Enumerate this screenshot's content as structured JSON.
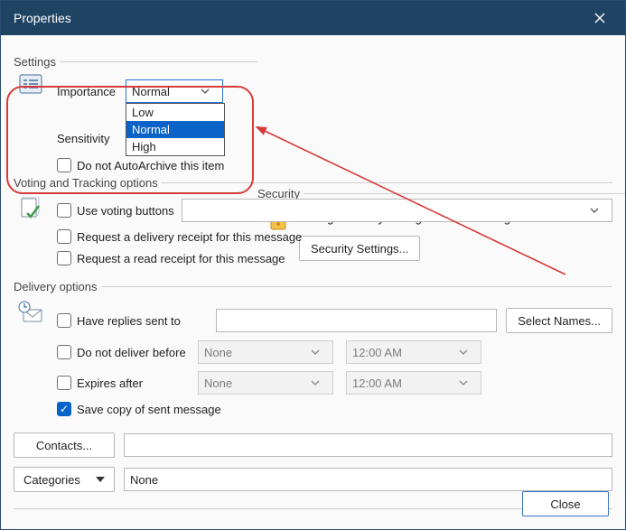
{
  "window": {
    "title": "Properties"
  },
  "settings": {
    "legend": "Settings",
    "importance_label": "Importance",
    "importance_value": "Normal",
    "importance_options": {
      "low": "Low",
      "normal": "Normal",
      "high": "High"
    },
    "sensitivity_label": "Sensitivity",
    "autoarchive_label": "Do not AutoArchive this item"
  },
  "security": {
    "legend": "Security",
    "desc": "Change security settings for this message.",
    "button": "Security Settings..."
  },
  "voting": {
    "legend": "Voting and Tracking options",
    "use_voting": "Use voting buttons",
    "delivery_receipt": "Request a delivery receipt for this message",
    "read_receipt": "Request a read receipt for this message"
  },
  "delivery": {
    "legend": "Delivery options",
    "have_replies": "Have replies sent to",
    "select_names": "Select Names...",
    "not_before": "Do not deliver before",
    "expires": "Expires after",
    "date_none": "None",
    "time_default": "12:00 AM",
    "save_copy": "Save copy of sent message"
  },
  "footer": {
    "contacts": "Contacts...",
    "categories": "Categories",
    "categories_value": "None",
    "close": "Close"
  }
}
